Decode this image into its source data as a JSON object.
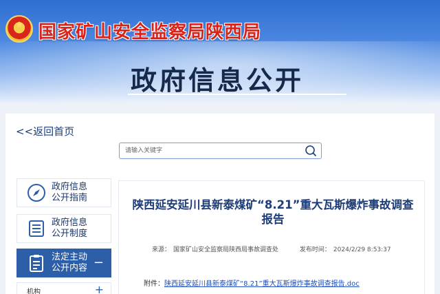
{
  "header": {
    "org_name": "国家矿山安全监察局陕西局",
    "banner_title": "政府信息公开"
  },
  "nav": {
    "back_label": "<<返回首页"
  },
  "search": {
    "placeholder": "请输入关键字"
  },
  "sidebar": {
    "items": [
      {
        "label_line1": "政府信息",
        "label_line2": "公开指南",
        "icon": "compass-icon"
      },
      {
        "label_line1": "政府信息",
        "label_line2": "公开制度",
        "icon": "document-list-icon"
      },
      {
        "label_line1": "法定主动",
        "label_line2": "公开内容",
        "icon": "clipboard-icon",
        "toggle": "−"
      }
    ],
    "sub_item": {
      "label": "机构",
      "toggle": "+"
    }
  },
  "article": {
    "title": "陕西延安延川县新泰煤矿“8.21”重大瓦斯爆炸事故调查报告",
    "source_label": "来源：",
    "source_value": "国家矿山安全监察局陕西局事故调查处",
    "date_label": "发布时间：",
    "date_value": "2024/2/29 8:53:37",
    "attachment_label": "附件：",
    "attachment_link": "陕西延安延川县新泰煤矿“8.21”重大瓦斯爆炸事故调查报告.doc"
  },
  "colors": {
    "org_red": "#d8231a",
    "title_navy": "#17294a",
    "active_blue": "#2d5ea8",
    "link_blue": "#1d4fb8"
  }
}
